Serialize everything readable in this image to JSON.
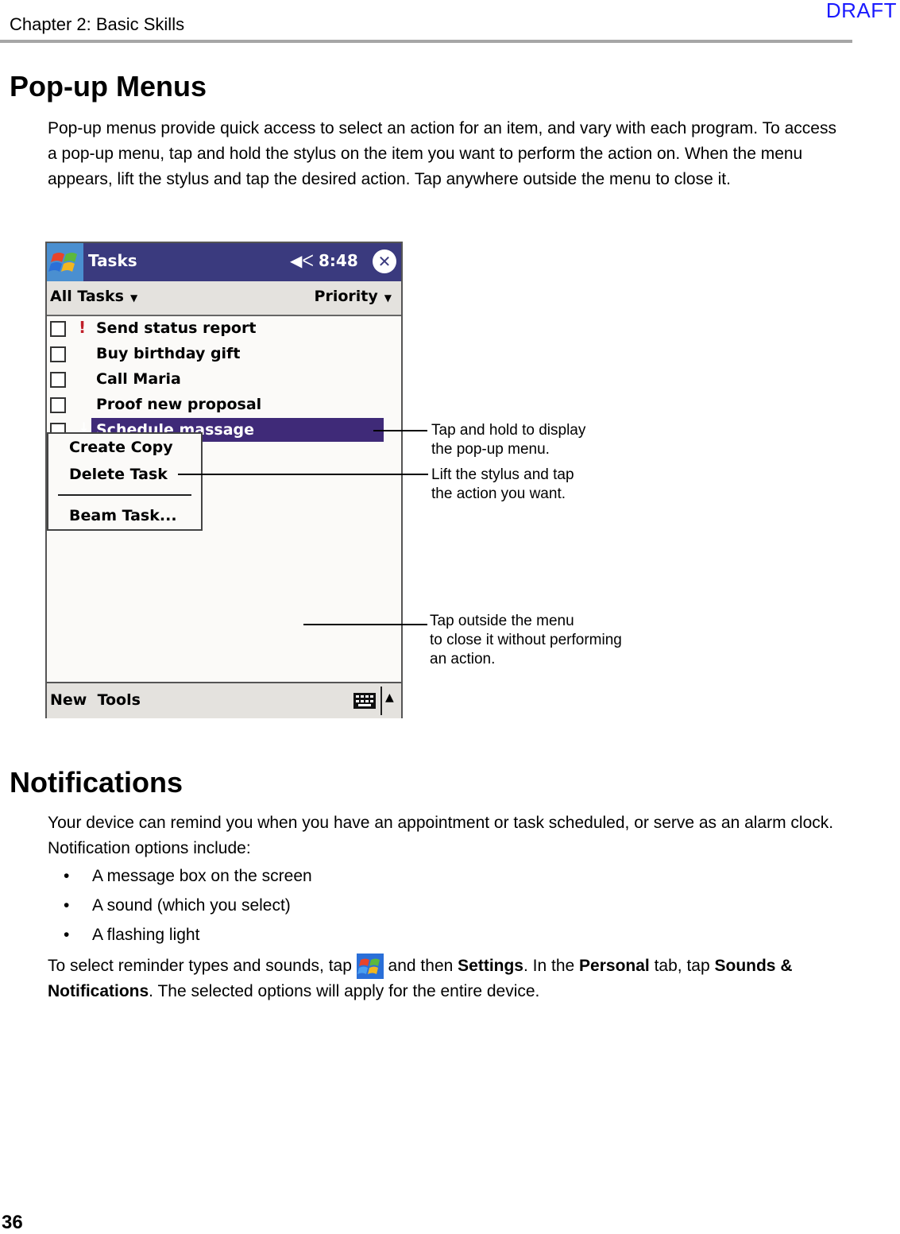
{
  "header": {
    "running_head": "Chapter 2: Basic Skills",
    "watermark": "DRAFT"
  },
  "section1": {
    "title": "Pop-up Menus",
    "paragraph": "Pop-up menus provide quick access to select an action for an item, and vary with each program. To access a pop-up menu, tap and hold the stylus on the item you want to perform the action on. When the menu appears, lift the stylus and tap the desired action. Tap anywhere outside the menu to close it."
  },
  "screenshot": {
    "app_title": "Tasks",
    "speaker_icon": "speaker-icon",
    "time": "8:48",
    "close_label": "✕",
    "filter_label": "All Tasks",
    "sort_label": "Priority",
    "tasks": [
      {
        "label": "Send status report",
        "priority": "!",
        "selected": false
      },
      {
        "label": "Buy birthday gift",
        "priority": "",
        "selected": false
      },
      {
        "label": "Call Maria",
        "priority": "",
        "selected": false
      },
      {
        "label": "Proof new proposal",
        "priority": "",
        "selected": false
      },
      {
        "label": "Schedule massage",
        "priority": "↓",
        "selected": true
      }
    ],
    "popup_menu": [
      "Create Copy",
      "Delete Task",
      "Beam Task..."
    ],
    "bottom_menu": "New  Tools",
    "colors": {
      "titlebar": "#3a3a7e",
      "selection": "#3f2a78",
      "priority": "#c0202a"
    }
  },
  "callouts": [
    {
      "line1": "Tap and hold to display",
      "line2": "the pop-up menu.",
      "line3": ""
    },
    {
      "line1": "Lift the stylus and tap",
      "line2": "the action you want.",
      "line3": ""
    },
    {
      "line1": "Tap outside the menu",
      "line2": "to close it without performing",
      "line3": "an action."
    }
  ],
  "section2": {
    "title": "Notifications",
    "paragraph": "Your device can remind you when you have an appointment or task scheduled, or serve as an alarm clock.  Notification options include:",
    "bullets": [
      "A message box on the screen",
      "A sound (which you select)",
      "A flashing light"
    ],
    "closing": {
      "t1": "To select reminder types and sounds, tap ",
      "t2": " and then ",
      "b1": "Settings",
      "t3": ". In the ",
      "b2": "Personal",
      "t4": " tab, tap ",
      "b3": "Sounds & Notifications",
      "t5": ". The selected options will apply for the entire device."
    }
  },
  "footer": {
    "page_number": "36"
  }
}
